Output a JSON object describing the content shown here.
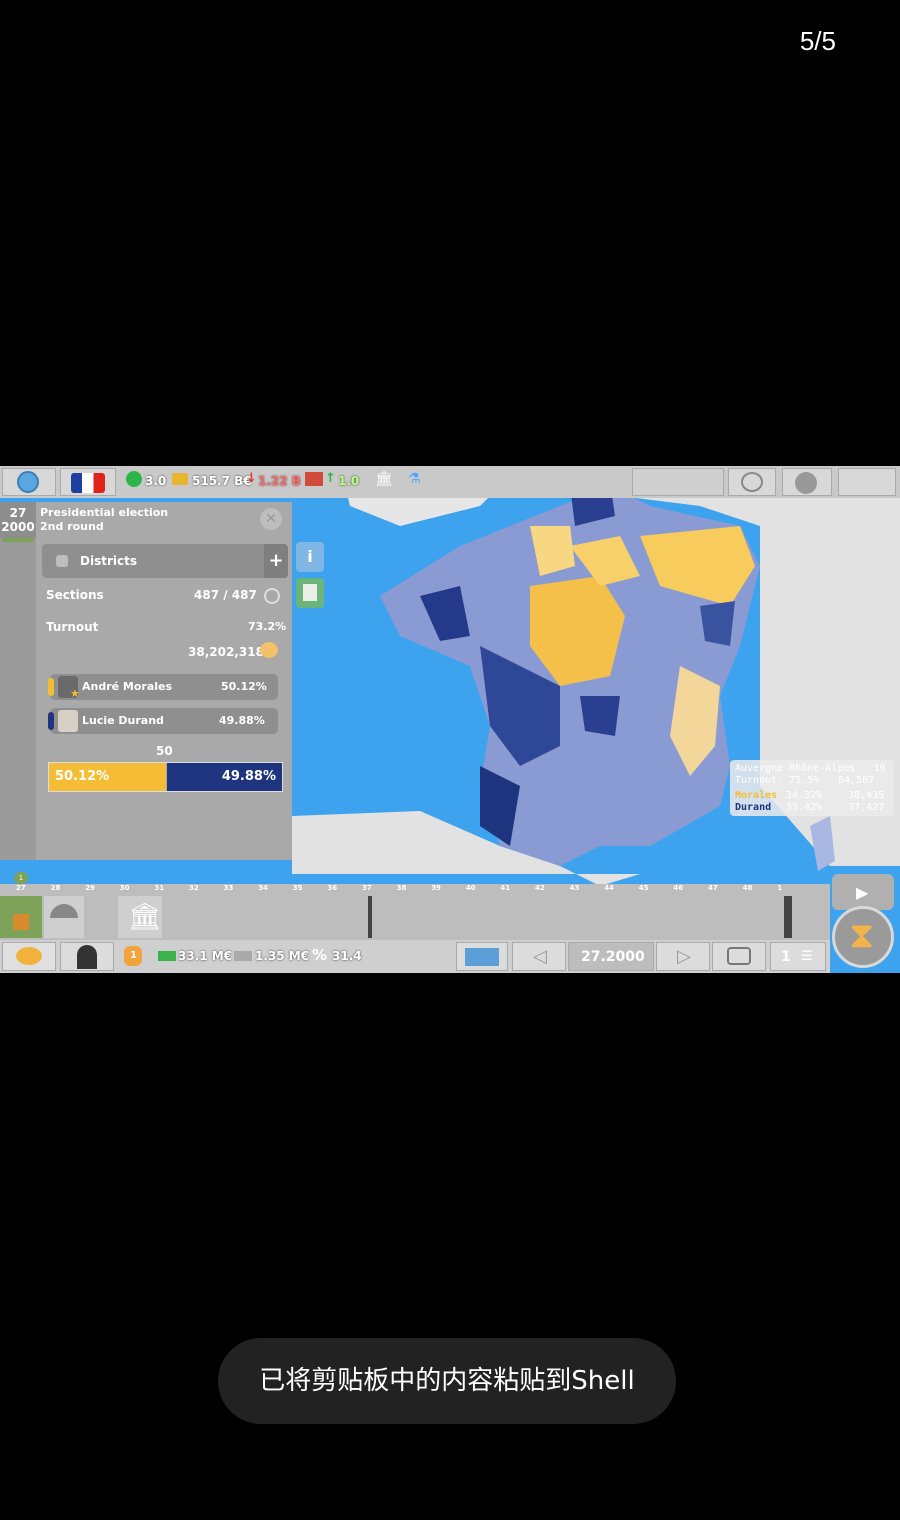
{
  "viewer": {
    "counter": "5/5"
  },
  "topbar": {
    "happiness": "3.0",
    "money": "515.7 B€",
    "money_change": "1.22 B",
    "industry": "1.0",
    "industry_suffix": "%"
  },
  "panel": {
    "date_day": "27",
    "date_year": "2000",
    "title": "Presidential election",
    "subtitle": "2nd round",
    "districts_label": "Districts",
    "sections_label": "Sections",
    "sections_value": "487 / 487",
    "turnout_label": "Turnout",
    "turnout_pct": "73.2%",
    "turnout_votes": "38,202,318",
    "candidates": [
      {
        "name": "André Morales",
        "pct": "50.12%",
        "color": "#f5bd35"
      },
      {
        "name": "Lucie Durand",
        "pct": "49.88%",
        "color": "#1e347f"
      }
    ],
    "midpoint": "50",
    "bar_left": "50.12%",
    "bar_right": "49.88%",
    "share_left": 50.12
  },
  "tooltip": {
    "region": "Auvergne-Rhône-Alpes - 19",
    "turnout": "Turnout: 75.5%",
    "turnout_votes": "84,507",
    "c1_name": "Morales",
    "c1_pct": "34.32%",
    "c1_votes": "38,435",
    "c2_name": "Durand",
    "c2_pct": "33.42%",
    "c2_votes": "37,427"
  },
  "timeline": {
    "weeks": [
      "27",
      "28",
      "29",
      "30",
      "31",
      "32",
      "33",
      "34",
      "35",
      "36",
      "37",
      "38",
      "39",
      "40",
      "41",
      "42",
      "43",
      "44",
      "45",
      "46",
      "47",
      "48",
      "1"
    ],
    "current_marker": "1"
  },
  "bottombar": {
    "hand_count": "1",
    "cash": "33.1 M€",
    "cost": "1.35 M€",
    "percent": "31.4",
    "date": "27.2000",
    "page": "1"
  },
  "toast": {
    "text": "已将剪贴板中的内容粘贴到Shell"
  },
  "colors": {
    "ocean": "#3ea3ef",
    "yellow": "#f5bd35",
    "navy": "#1e347f",
    "land_grey": "#e2e2e2"
  }
}
